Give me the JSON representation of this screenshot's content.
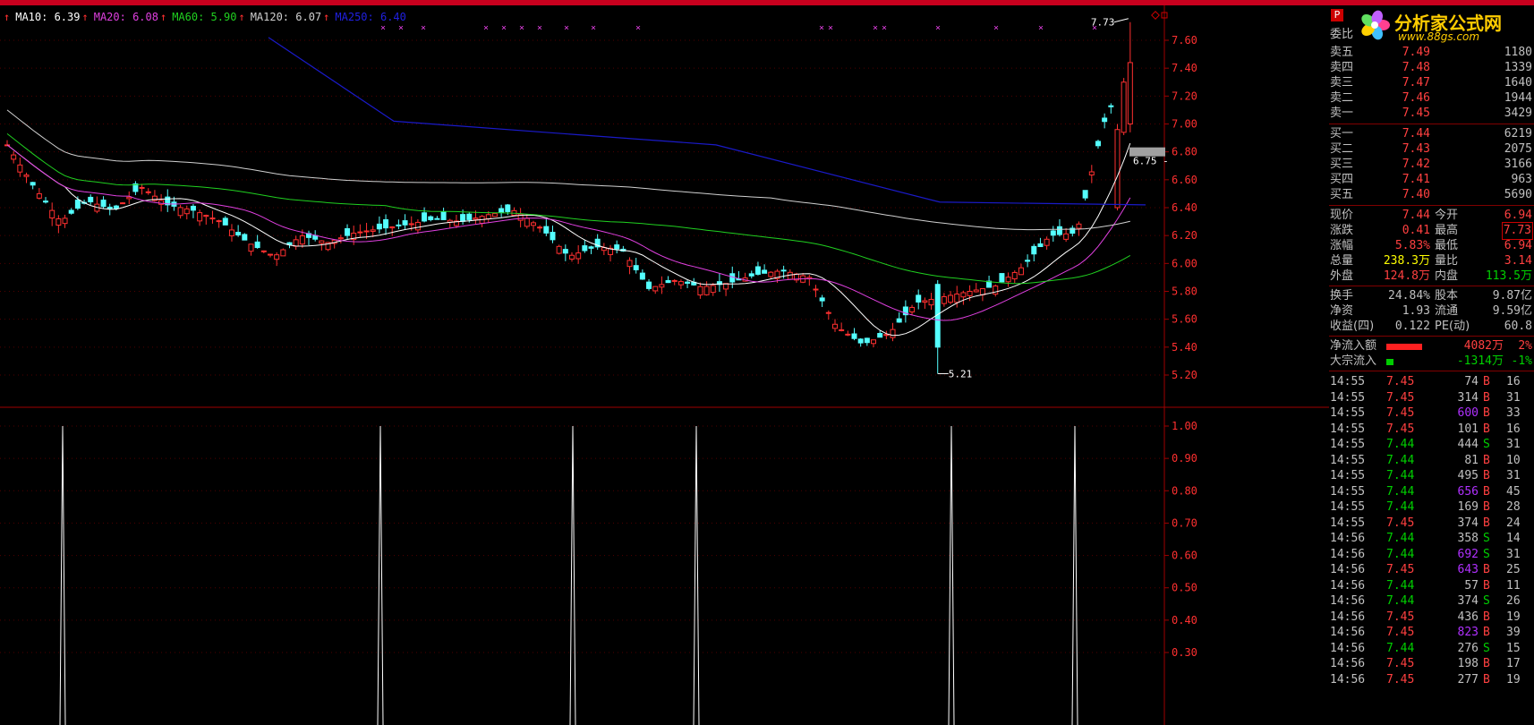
{
  "ma_legend": [
    {
      "label": "MA10: 6.39",
      "color": "#ffffff"
    },
    {
      "label": "MA20: 6.08",
      "color": "#e040e0"
    },
    {
      "label": "MA60: 5.90",
      "color": "#20d020"
    },
    {
      "label": "MA120: 6.07",
      "color": "#d0d0d0"
    },
    {
      "label": "MA250: 6.40",
      "color": "#2020e0"
    }
  ],
  "main_axis": {
    "ticks": [
      "7.60",
      "7.40",
      "7.20",
      "7.00",
      "6.80",
      "6.60",
      "6.40",
      "6.20",
      "6.00",
      "5.80",
      "5.60",
      "5.40",
      "5.20"
    ]
  },
  "annotations": {
    "high": "7.73",
    "low": "5.21",
    "current": "6.75"
  },
  "sub_axis": {
    "ticks": [
      "1.00",
      "0.90",
      "0.80",
      "0.70",
      "0.60",
      "0.50",
      "0.40",
      "0.30"
    ]
  },
  "logo": {
    "title": "分析家公式网",
    "url": "www.88gs.com",
    "badge": "P"
  },
  "order_book": {
    "wei_bi_label": "委比",
    "asks": [
      {
        "label": "卖五",
        "price": "7.49",
        "vol": "1180"
      },
      {
        "label": "卖四",
        "price": "7.48",
        "vol": "1339"
      },
      {
        "label": "卖三",
        "price": "7.47",
        "vol": "1640"
      },
      {
        "label": "卖二",
        "price": "7.46",
        "vol": "1944"
      },
      {
        "label": "卖一",
        "price": "7.45",
        "vol": "3429"
      }
    ],
    "bids": [
      {
        "label": "买一",
        "price": "7.44",
        "vol": "6219"
      },
      {
        "label": "买二",
        "price": "7.43",
        "vol": "2075"
      },
      {
        "label": "买三",
        "price": "7.42",
        "vol": "3166"
      },
      {
        "label": "买四",
        "price": "7.41",
        "vol": "963"
      },
      {
        "label": "买五",
        "price": "7.40",
        "vol": "5690"
      }
    ]
  },
  "stats": [
    {
      "l1": "现价",
      "v1": "7.44",
      "c1": "red",
      "l2": "今开",
      "v2": "6.94",
      "c2": "red",
      "box": false
    },
    {
      "l1": "涨跌",
      "v1": "0.41",
      "c1": "red",
      "l2": "最高",
      "v2": "7.73",
      "c2": "red",
      "box": true
    },
    {
      "l1": "涨幅",
      "v1": "5.83%",
      "c1": "red",
      "l2": "最低",
      "v2": "6.94",
      "c2": "red",
      "box": false
    },
    {
      "l1": "总量",
      "v1": "238.3万",
      "c1": "yellow",
      "l2": "量比",
      "v2": "3.14",
      "c2": "red",
      "box": false
    },
    {
      "l1": "外盘",
      "v1": "124.8万",
      "c1": "red",
      "l2": "内盘",
      "v2": "113.5万",
      "c2": "green",
      "box": false
    }
  ],
  "fundamentals": [
    {
      "l1": "换手",
      "v1": "24.84%",
      "l2": "股本",
      "v2": "9.87亿"
    },
    {
      "l1": "净资",
      "v1": "1.93",
      "l2": "流通",
      "v2": "9.59亿"
    },
    {
      "l1": "收益(四)",
      "v1": "0.122",
      "l2": "PE(动)",
      "v2": "60.8"
    }
  ],
  "flows": [
    {
      "label": "净流入额",
      "value": "4082万",
      "pct": "2%",
      "bar_color": "#ff2020",
      "bar_width": 0.8,
      "cls": "red"
    },
    {
      "label": "大宗流入",
      "value": "-1314万",
      "pct": "-1%",
      "bar_color": "#00cc00",
      "bar_width": 0.15,
      "cls": "green"
    }
  ],
  "ticks": [
    {
      "time": "14:55",
      "price": "7.45",
      "vol": "74",
      "side": "B",
      "count": "16",
      "up": true,
      "big": false
    },
    {
      "time": "14:55",
      "price": "7.45",
      "vol": "314",
      "side": "B",
      "count": "31",
      "up": true,
      "big": false
    },
    {
      "time": "14:55",
      "price": "7.45",
      "vol": "600",
      "side": "B",
      "count": "33",
      "up": true,
      "big": true
    },
    {
      "time": "14:55",
      "price": "7.45",
      "vol": "101",
      "side": "B",
      "count": "16",
      "up": true,
      "big": false
    },
    {
      "time": "14:55",
      "price": "7.44",
      "vol": "444",
      "side": "S",
      "count": "31",
      "up": false,
      "big": false
    },
    {
      "time": "14:55",
      "price": "7.44",
      "vol": "81",
      "side": "B",
      "count": "10",
      "up": false,
      "big": false
    },
    {
      "time": "14:55",
      "price": "7.44",
      "vol": "495",
      "side": "B",
      "count": "31",
      "up": false,
      "big": false
    },
    {
      "time": "14:55",
      "price": "7.44",
      "vol": "656",
      "side": "B",
      "count": "45",
      "up": false,
      "big": true
    },
    {
      "time": "14:55",
      "price": "7.44",
      "vol": "169",
      "side": "B",
      "count": "28",
      "up": false,
      "big": false
    },
    {
      "time": "14:55",
      "price": "7.45",
      "vol": "374",
      "side": "B",
      "count": "24",
      "up": true,
      "big": false
    },
    {
      "time": "14:56",
      "price": "7.44",
      "vol": "358",
      "side": "S",
      "count": "14",
      "up": false,
      "big": false
    },
    {
      "time": "14:56",
      "price": "7.44",
      "vol": "692",
      "side": "S",
      "count": "31",
      "up": false,
      "big": true
    },
    {
      "time": "14:56",
      "price": "7.45",
      "vol": "643",
      "side": "B",
      "count": "25",
      "up": true,
      "big": true
    },
    {
      "time": "14:56",
      "price": "7.44",
      "vol": "57",
      "side": "B",
      "count": "11",
      "up": false,
      "big": false
    },
    {
      "time": "14:56",
      "price": "7.44",
      "vol": "374",
      "side": "S",
      "count": "26",
      "up": false,
      "big": false
    },
    {
      "time": "14:56",
      "price": "7.45",
      "vol": "436",
      "side": "B",
      "count": "19",
      "up": true,
      "big": false
    },
    {
      "time": "14:56",
      "price": "7.45",
      "vol": "823",
      "side": "B",
      "count": "39",
      "up": true,
      "big": true
    },
    {
      "time": "14:56",
      "price": "7.44",
      "vol": "276",
      "side": "S",
      "count": "15",
      "up": false,
      "big": false
    },
    {
      "time": "14:56",
      "price": "7.45",
      "vol": "198",
      "side": "B",
      "count": "17",
      "up": true,
      "big": false
    },
    {
      "time": "14:56",
      "price": "7.45",
      "vol": "277",
      "side": "B",
      "count": "19",
      "up": true,
      "big": false
    }
  ],
  "colors": {
    "up": "#ff4040",
    "down": "#00d000",
    "bear_candle": "#54ffff",
    "bull_candle": "#ff3030",
    "grid": "#800000"
  }
}
